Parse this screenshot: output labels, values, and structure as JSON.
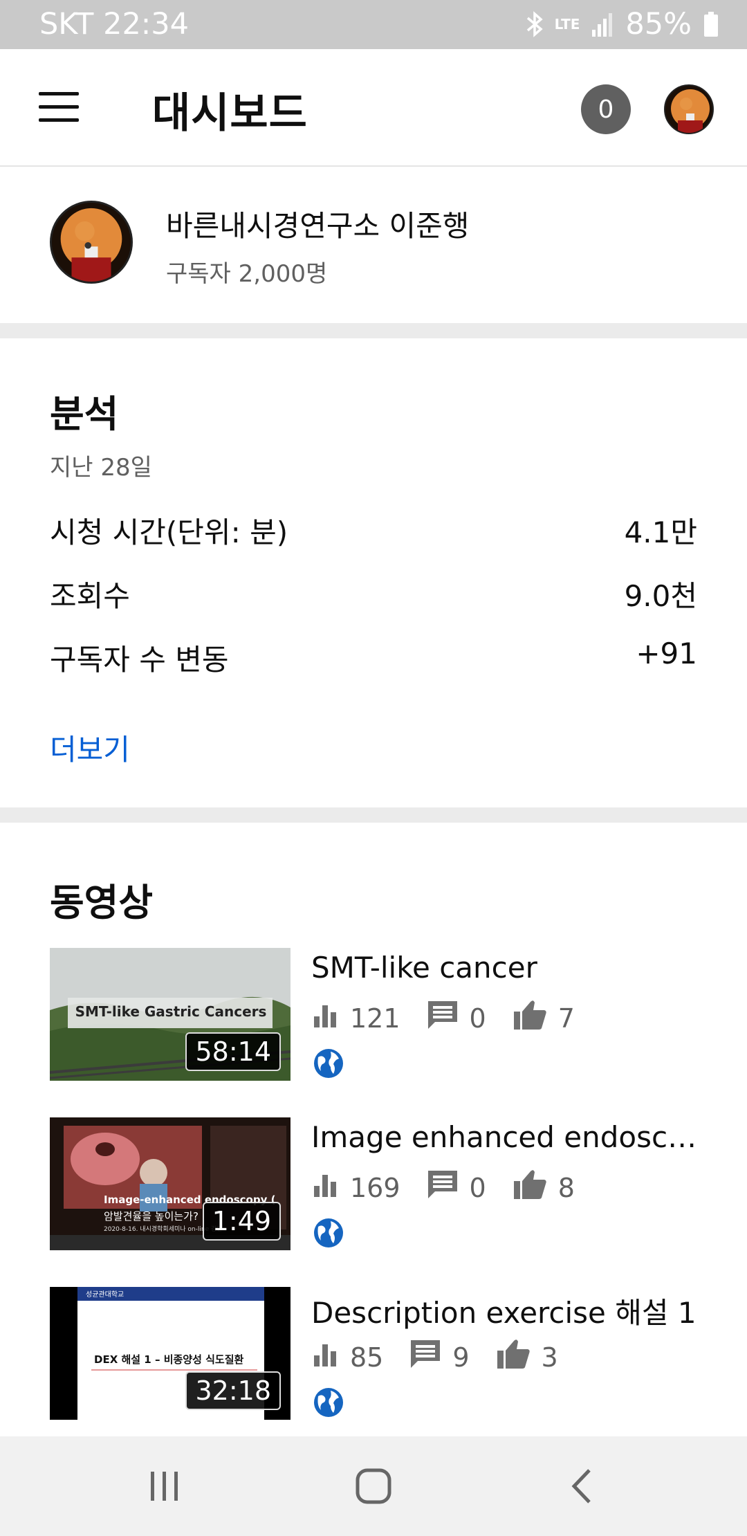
{
  "status_bar": {
    "carrier_time": "SKT 22:34",
    "network": "LTE",
    "battery": "85%",
    "icons": [
      "bluetooth-icon",
      "lte-icon",
      "signal-icon",
      "battery-icon"
    ]
  },
  "header": {
    "title": "대시보드",
    "notifications": "0",
    "menu_icon": "hamburger-menu-icon"
  },
  "channel": {
    "name": "바른내시경연구소 이준행",
    "subscribers": "구독자 2,000명"
  },
  "analytics": {
    "title": "분석",
    "period": "지난 28일",
    "metrics": [
      {
        "label": "시청 시간(단위: 분)",
        "value": "4.1만"
      },
      {
        "label": "조회수",
        "value": "9.0천"
      },
      {
        "label": "구독자 수 변동",
        "value": "+91"
      }
    ],
    "more": "더보기"
  },
  "videos": {
    "title": "동영상",
    "items": [
      {
        "title": "SMT-like cancer",
        "thumb_text": "SMT-like Gastric Cancers",
        "duration": "58:14",
        "views": "121",
        "comments": "0",
        "likes": "7",
        "visibility_icon": "globe-icon"
      },
      {
        "title": "Image enhanced endosco...",
        "thumb_text": "Image-enhanced endoscopy (",
        "thumb_subtext": "암발견율을 높이는가?",
        "thumb_caption": "2020-8-16. 내시경학회세미나 on-line 강연",
        "duration": "1:49",
        "views": "169",
        "comments": "0",
        "likes": "8",
        "visibility_icon": "globe-icon"
      },
      {
        "title": "Description exercise 해설 1",
        "thumb_text": "DEX 해설 1 – 비종양성 식도질환",
        "thumb_header": "성균관대학교",
        "duration": "32:18",
        "views": "85",
        "comments": "9",
        "likes": "3",
        "visibility_icon": "globe-icon"
      }
    ]
  },
  "nav_bar": {
    "icons": [
      "recent-apps-icon",
      "home-icon",
      "back-icon"
    ]
  },
  "colors": {
    "link": "#065fd4",
    "divider": "#ebebeb",
    "statusbar": "#c9c9c9",
    "navbar": "#f1f1f1"
  }
}
